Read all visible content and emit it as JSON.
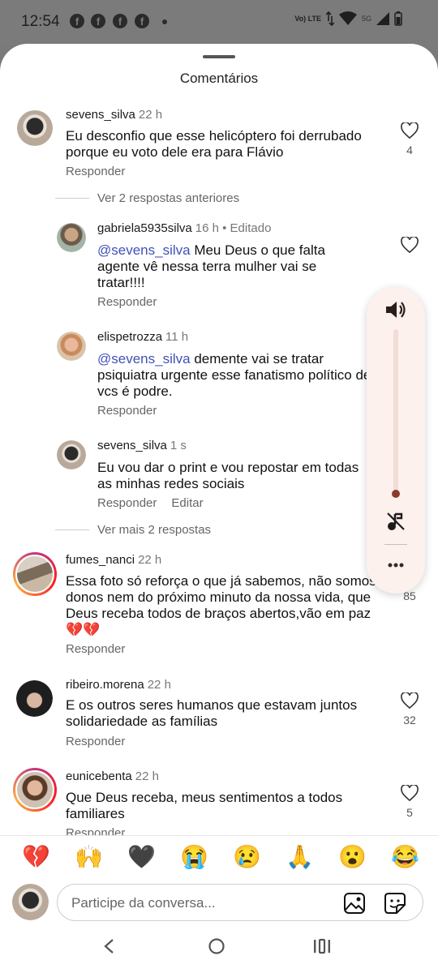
{
  "status_bar": {
    "time": "12:54",
    "notification_icons": [
      "facebook-icon",
      "facebook-icon",
      "facebook-icon",
      "facebook-icon"
    ],
    "network": "Vo) LTE",
    "network_2": "5G"
  },
  "sheet": {
    "title": "Comentários"
  },
  "comments": [
    {
      "user": "sevens_silva",
      "time": "22 h",
      "text": "Eu desconfio que esse helicóptero foi derrubado porque eu voto dele era para Flávio",
      "reply_label": "Responder",
      "likes": "4"
    },
    {
      "user": "fumes_nanci",
      "time": "22 h",
      "text": "Essa foto só reforça o que já sabemos, não somos donos nem do próximo minuto da nossa vida, que Deus receba todos de braços abertos,vão em paz 💔💔",
      "reply_label": "Responder",
      "likes": "85"
    },
    {
      "user": "ribeiro.morena",
      "time": "22 h",
      "text": "E os outros  seres humanos  que estavam juntos solidariedade  as famílias",
      "reply_label": "Responder",
      "likes": "32"
    },
    {
      "user": "eunicebenta",
      "time": "22 h",
      "text": "Que Deus receba, meus sentimentos a todos familiares",
      "reply_label": "Responder",
      "likes": "5"
    }
  ],
  "thread": {
    "previous_link": "Ver 2 respostas anteriores",
    "more_link": "Ver mais 2 respostas",
    "replies": [
      {
        "user": "gabriela5935silva",
        "time": "16 h",
        "edited": " • Editado",
        "mention": "@sevens_silva",
        "text": " Meu Deus o que falta agente vê nessa terra mulher vai se tratar!!!!",
        "reply_label": "Responder"
      },
      {
        "user": "elispetrozza",
        "time": "11 h",
        "mention": "@sevens_silva",
        "text": " demente vai se tratar psiquiatra urgente esse fanatismo político de vcs é podre.",
        "reply_label": "Responder"
      },
      {
        "user": "sevens_silva",
        "time": "1 s",
        "text": "Eu vou dar o print e vou repostar em todas as minhas redes sociais",
        "reply_label": "Responder",
        "edit_label": "Editar"
      }
    ]
  },
  "volume_panel": {
    "level": 0.0,
    "icons": [
      "speaker-icon",
      "music-off-icon",
      "more-icon"
    ]
  },
  "emoji_bar": [
    "💔",
    "🙌",
    "🖤",
    "😭",
    "😢",
    "🙏",
    "😮",
    "😂"
  ],
  "composer": {
    "placeholder": "Participe da conversa..."
  },
  "colors": {
    "mention": "#3f51b5",
    "panel_bg": "#fdf1ee",
    "volume_dot": "#8a3b2a"
  }
}
